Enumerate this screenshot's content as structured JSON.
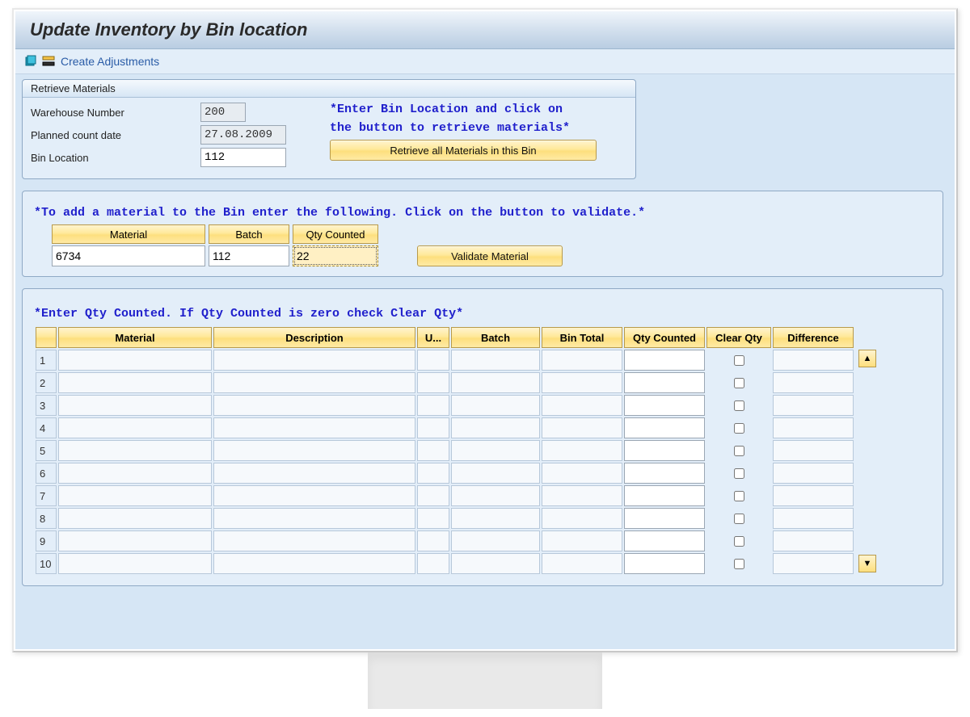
{
  "title": "Update Inventory by Bin location",
  "toolbar": {
    "create_adjustments": "Create Adjustments"
  },
  "retrieve": {
    "panel_title": "Retrieve Materials",
    "warehouse_label": "Warehouse Number",
    "warehouse_value": "200",
    "date_label": "Planned count date",
    "date_value": "27.08.2009",
    "bin_label": "Bin Location",
    "bin_value": "112",
    "hint_line1": "*Enter Bin Location and click on",
    "hint_line2": "the button to retrieve materials*",
    "retrieve_btn": "Retrieve all Materials in this Bin"
  },
  "add_material": {
    "hint": "*To add a material to the Bin enter the following. Click on the button to validate.*",
    "cols": {
      "material": "Material",
      "batch": "Batch",
      "qty": "Qty Counted"
    },
    "vals": {
      "material": "6734",
      "batch": "112",
      "qty": "22"
    },
    "validate_btn": "Validate Material"
  },
  "grid": {
    "hint": "*Enter Qty Counted. If Qty Counted is zero check Clear Qty*",
    "columns": {
      "material": "Material",
      "description": "Description",
      "uom": "U...",
      "batch": "Batch",
      "bin_total": "Bin Total",
      "qty_counted": "Qty Counted",
      "clear_qty": "Clear Qty",
      "difference": "Difference"
    },
    "rows": [
      {
        "n": "1"
      },
      {
        "n": "2"
      },
      {
        "n": "3"
      },
      {
        "n": "4"
      },
      {
        "n": "5"
      },
      {
        "n": "6"
      },
      {
        "n": "7"
      },
      {
        "n": "8"
      },
      {
        "n": "9"
      },
      {
        "n": "10"
      }
    ]
  }
}
